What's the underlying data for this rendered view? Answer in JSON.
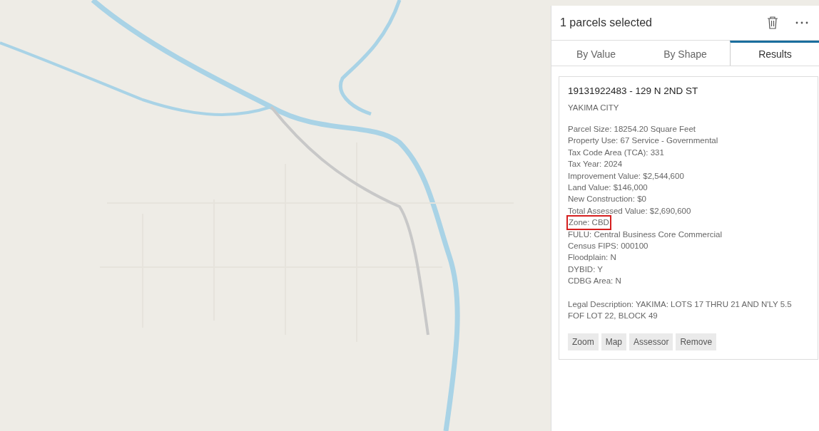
{
  "panel": {
    "title": "1 parcels selected",
    "tabs": [
      {
        "label": "By Value",
        "selected": false
      },
      {
        "label": "By Shape",
        "selected": false
      },
      {
        "label": "Results",
        "selected": true
      }
    ],
    "result": {
      "heading": "19131922483 - 129 N 2ND ST",
      "jurisdiction": "YAKIMA CITY",
      "attributes": [
        {
          "text": "Parcel Size: 18254.20 Square Feet",
          "highlighted": false
        },
        {
          "text": "Property Use: 67 Service - Governmental",
          "highlighted": false
        },
        {
          "text": "Tax Code Area (TCA): 331",
          "highlighted": false
        },
        {
          "text": "Tax Year: 2024",
          "highlighted": false
        },
        {
          "text": "Improvement Value: $2,544,600",
          "highlighted": false
        },
        {
          "text": "Land Value: $146,000",
          "highlighted": false
        },
        {
          "text": "New Construction: $0",
          "highlighted": false
        },
        {
          "text": "Total Assessed Value: $2,690,600",
          "highlighted": false
        },
        {
          "text": "Zone: CBD",
          "highlighted": true
        },
        {
          "text": "FULU: Central Business Core Commercial",
          "highlighted": false
        },
        {
          "text": "Census FIPS: 000100",
          "highlighted": false
        },
        {
          "text": "Floodplain: N",
          "highlighted": false
        },
        {
          "text": "DYBID: Y",
          "highlighted": false
        },
        {
          "text": "CDBG Area: N",
          "highlighted": false
        }
      ],
      "legal_description": "Legal Description: YAKIMA: LOTS 17 THRU 21 AND N'LY 5.5 FOF LOT 22, BLOCK 49",
      "buttons": [
        "Zoom",
        "Map",
        "Assessor",
        "Remove"
      ]
    }
  }
}
